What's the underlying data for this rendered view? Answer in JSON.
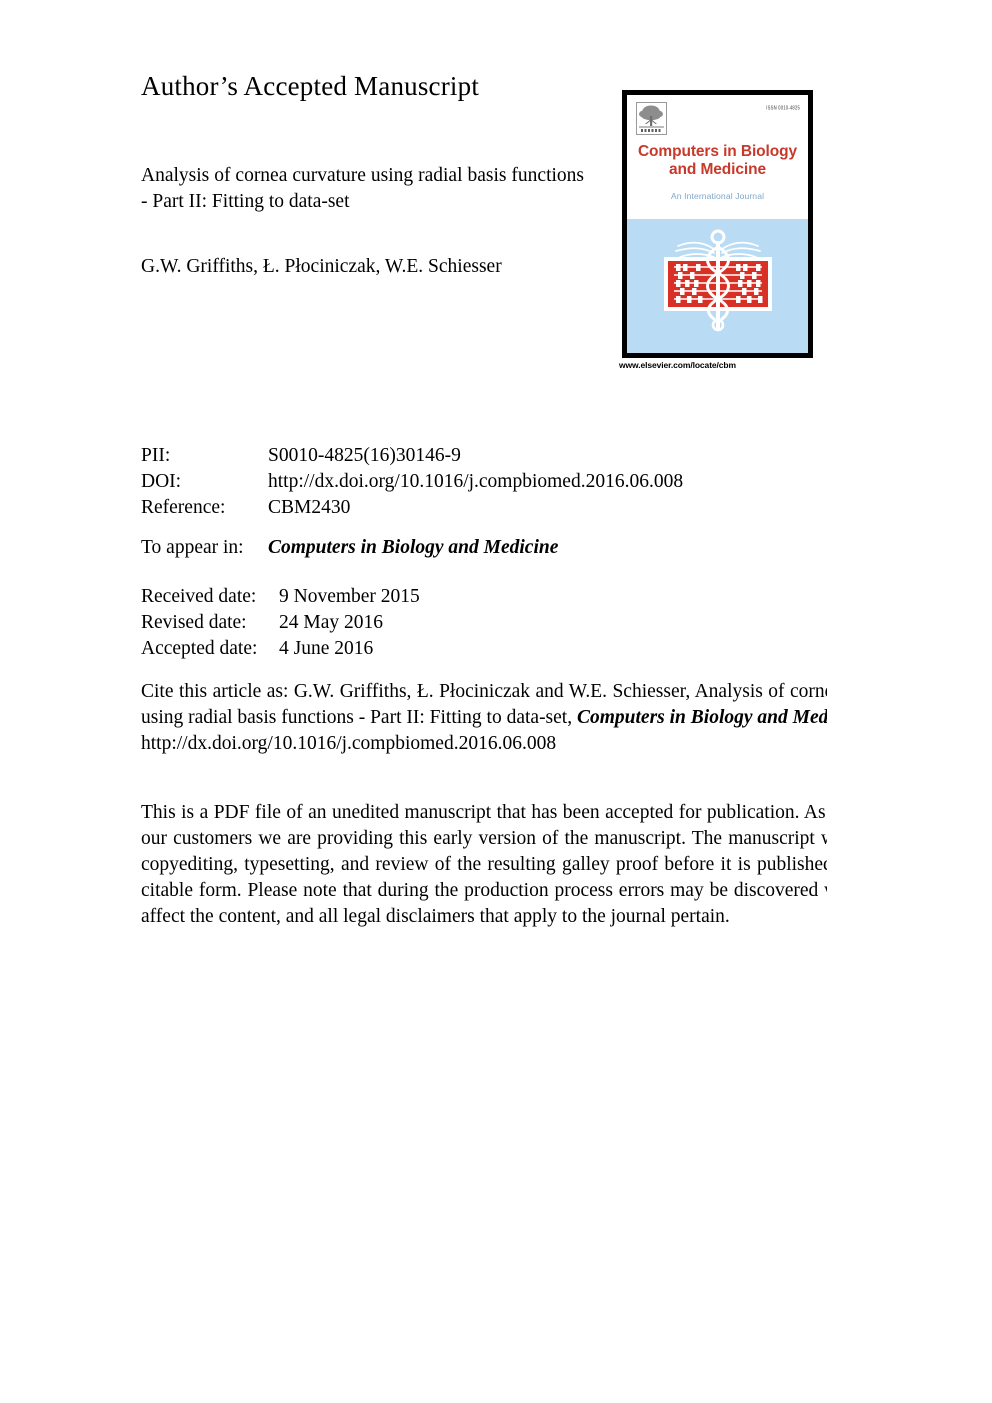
{
  "header": {
    "accepted_manuscript": "Author’s Accepted Manuscript"
  },
  "article": {
    "title": "Analysis of cornea curvature using radial basis functions - Part II: Fitting to data-set",
    "authors": "G.W. Griffiths, Ł. Płociniczak, W.E. Schiesser"
  },
  "cover": {
    "publisher_logo": "elsevier-tree-logo",
    "issn": "ISSN 0010-4825",
    "title_line1": "Computers in Biology",
    "title_line2": "and Medicine",
    "subtitle": "An International Journal",
    "emblem": "caduceus-abacus-emblem",
    "url": "www.elsevier.com/locate/cbm",
    "colors": {
      "title_red": "#c8392b",
      "subtitle_blue": "#7fa8c9",
      "panel_blue": "#b9dcf4",
      "emblem_red": "#d93025",
      "border_black": "#000000"
    }
  },
  "metadata": {
    "rows": [
      {
        "label": "PII:",
        "value": "S0010-4825(16)30146-9"
      },
      {
        "label": "DOI:",
        "value": "http://dx.doi.org/10.1016/j.compbiomed.2016.06.008"
      },
      {
        "label": "Reference:",
        "value": "CBM2430"
      }
    ]
  },
  "to_appear": {
    "label": "To appear in:",
    "journal": "Computers in Biology and Medicine"
  },
  "dates": {
    "rows": [
      {
        "label": "Received date:",
        "value": "9 November 2015"
      },
      {
        "label": "Revised date:",
        "value": "24 May 2016"
      },
      {
        "label": "Accepted date:",
        "value": "4 June 2016"
      }
    ]
  },
  "citation": {
    "prefix": "Cite this article as: G.W. Griffiths, Ł. Płociniczak and W.E. Schiesser, Analysis of cornea curvature using radial basis functions - Part II: Fitting to data-set, ",
    "journal_italic": "Computers in Biology and Medicine",
    "doi": "http://dx.doi.org/10.1016/j.compbiomed.2016.06.008"
  },
  "disclaimer": {
    "text": "This is a PDF file of an unedited manuscript that has been accepted for publication. As a service to our customers we are providing this early version of the manuscript. The manuscript will undergo copyediting, typesetting, and review of the resulting galley proof before it is published in its final citable form. Please note that during the production process errors may be discovered which could affect the content, and all legal disclaimers that apply to the journal pertain."
  }
}
